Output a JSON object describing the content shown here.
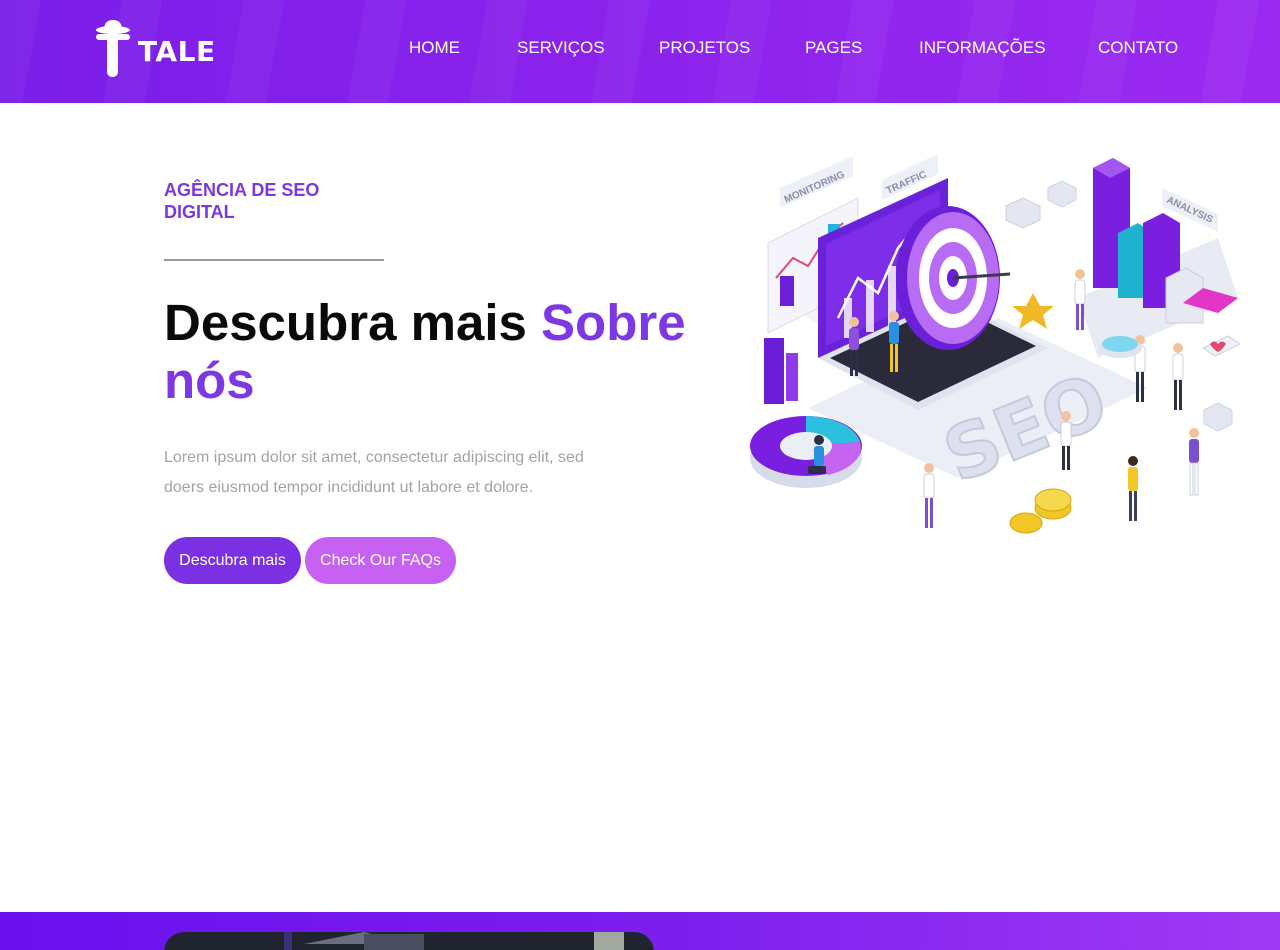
{
  "brand": {
    "name": "TALE"
  },
  "nav": {
    "items": [
      {
        "label": "HOME"
      },
      {
        "label": "SERVIÇOS"
      },
      {
        "label": "PROJETOS"
      },
      {
        "label": "PAGES"
      },
      {
        "label": "INFORMAÇÕES"
      },
      {
        "label": "CONTATO"
      }
    ]
  },
  "hero": {
    "eyebrow": "AGÊNCIA DE SEO DIGITAL",
    "headline_main": "Descubra mais",
    "headline_accent": "Sobre nós",
    "lead": "Lorem ipsum dolor sit amet, consectetur adipiscing elit, sed doers eiusmod tempor incididunt ut labore et dolore.",
    "primary_button": "Descubra mais",
    "secondary_button": "Check Our FAQs"
  },
  "illustration": {
    "labels": {
      "monitoring": "MONITORING",
      "traffic": "TRAFFIC",
      "analysis": "ANALYSIS",
      "seo": "SEO"
    }
  },
  "colors": {
    "header": "#8a22ec",
    "accent": "#7b36e6",
    "button_primary": "#7b30e4",
    "button_secondary": "#c761f2",
    "lead_text": "#a3a3a3"
  }
}
